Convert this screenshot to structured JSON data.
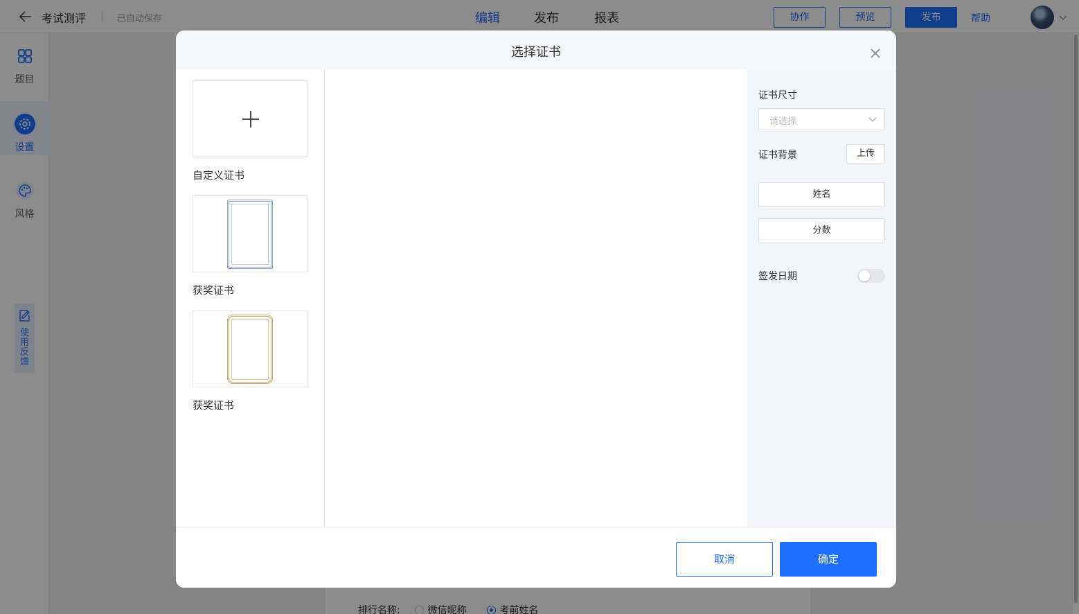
{
  "header": {
    "back_icon": "arrow-left-icon",
    "title": "考试测评",
    "autosave": "已自动保存",
    "tabs": [
      {
        "label": "编辑",
        "active": true
      },
      {
        "label": "发布",
        "active": false
      },
      {
        "label": "报表",
        "active": false
      }
    ],
    "collaborate": "协作",
    "preview": "预览",
    "publish": "发布",
    "help": "帮助"
  },
  "sidebar": {
    "items": [
      {
        "label": "题目",
        "icon": "grid-icon",
        "active": false
      },
      {
        "label": "设置",
        "icon": "gear-icon",
        "active": true
      },
      {
        "label": "风格",
        "icon": "palette-icon",
        "active": false
      }
    ],
    "feedback": "使用反馈"
  },
  "background": {
    "rank_label": "排行名称:",
    "rank_options": [
      {
        "label": "微信昵称",
        "selected": false
      },
      {
        "label": "考前姓名",
        "selected": true
      }
    ]
  },
  "modal": {
    "title": "选择证书",
    "templates": [
      {
        "name": "自定义证书",
        "kind": "add"
      },
      {
        "name": "获奖证书",
        "kind": "blue-frame"
      },
      {
        "name": "获奖证书",
        "kind": "gold-frame"
      }
    ],
    "props": {
      "size_label": "证书尺寸",
      "size_placeholder": "请选择",
      "background_label": "证书背景",
      "upload": "上传",
      "fields": [
        "姓名",
        "分数"
      ],
      "date_label": "签发日期",
      "date_enabled": false
    },
    "cancel": "取消",
    "confirm": "确定"
  },
  "colors": {
    "accent": "#1e6fff",
    "overlay": "rgba(0,0,0,0.45)",
    "props_bg": "#f2f5fa"
  }
}
